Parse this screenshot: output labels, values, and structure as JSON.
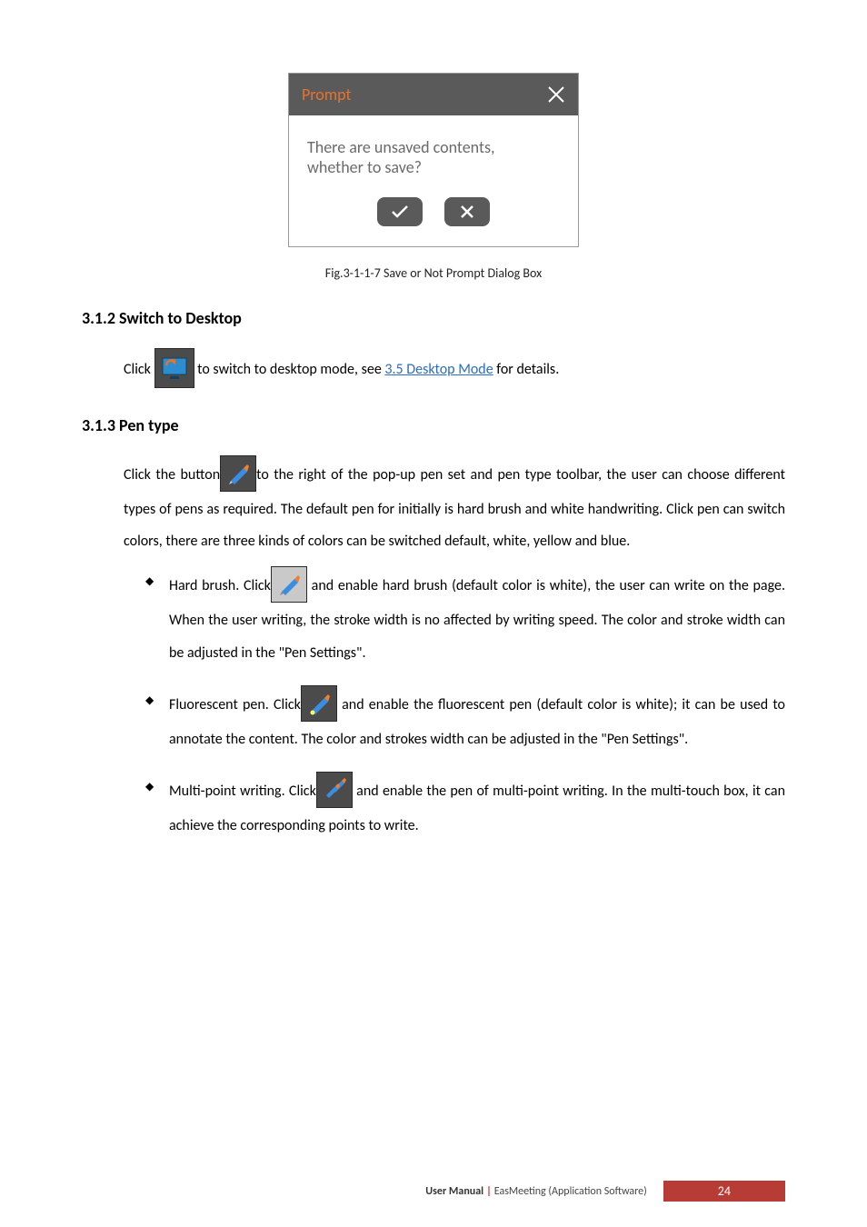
{
  "dialog": {
    "title": "Prompt",
    "message_line1": "There are unsaved contents,",
    "message_line2": "whether to save?"
  },
  "caption": "Fig.3-1-1-7 Save or Not Prompt Dialog Box",
  "section_312": {
    "heading": "3.1.2 Switch to Desktop",
    "text_pre": "Click ",
    "text_post": " to switch to desktop mode, see ",
    "link": "3.5 Desktop Mode",
    "text_end": " for details."
  },
  "section_313": {
    "heading": "3.1.3 Pen type",
    "intro_pre": "Click the button",
    "intro_post": "to the right of the pop-up pen set and pen type toolbar, the user can choose different types of pens as required. The default pen for initially is hard brush and white handwriting. Click pen can switch colors, there are three kinds of colors can be switched default, white, yellow and blue.",
    "bullets": [
      {
        "label_pre": "Hard brush. Click",
        "label_post": " and enable hard brush (default color is white), the user can write on the page. When the user writing, the stroke width is no affected by writing speed. The color and stroke width can be adjusted in the \"Pen Settings\"."
      },
      {
        "label_pre": "Fluorescent pen. Click",
        "label_post": " and enable the fluorescent pen (default color is white); it can be used to annotate the content. The color and strokes width can be adjusted in the \"Pen Settings\"."
      },
      {
        "label_pre": "Multi-point writing. Click",
        "label_post": " and enable the pen of multi-point writing. In the multi-touch box, it can achieve the corresponding points to write."
      }
    ]
  },
  "footer": {
    "left": "User Manual",
    "right": "EasMeeting (Application Software)",
    "page": "24"
  }
}
